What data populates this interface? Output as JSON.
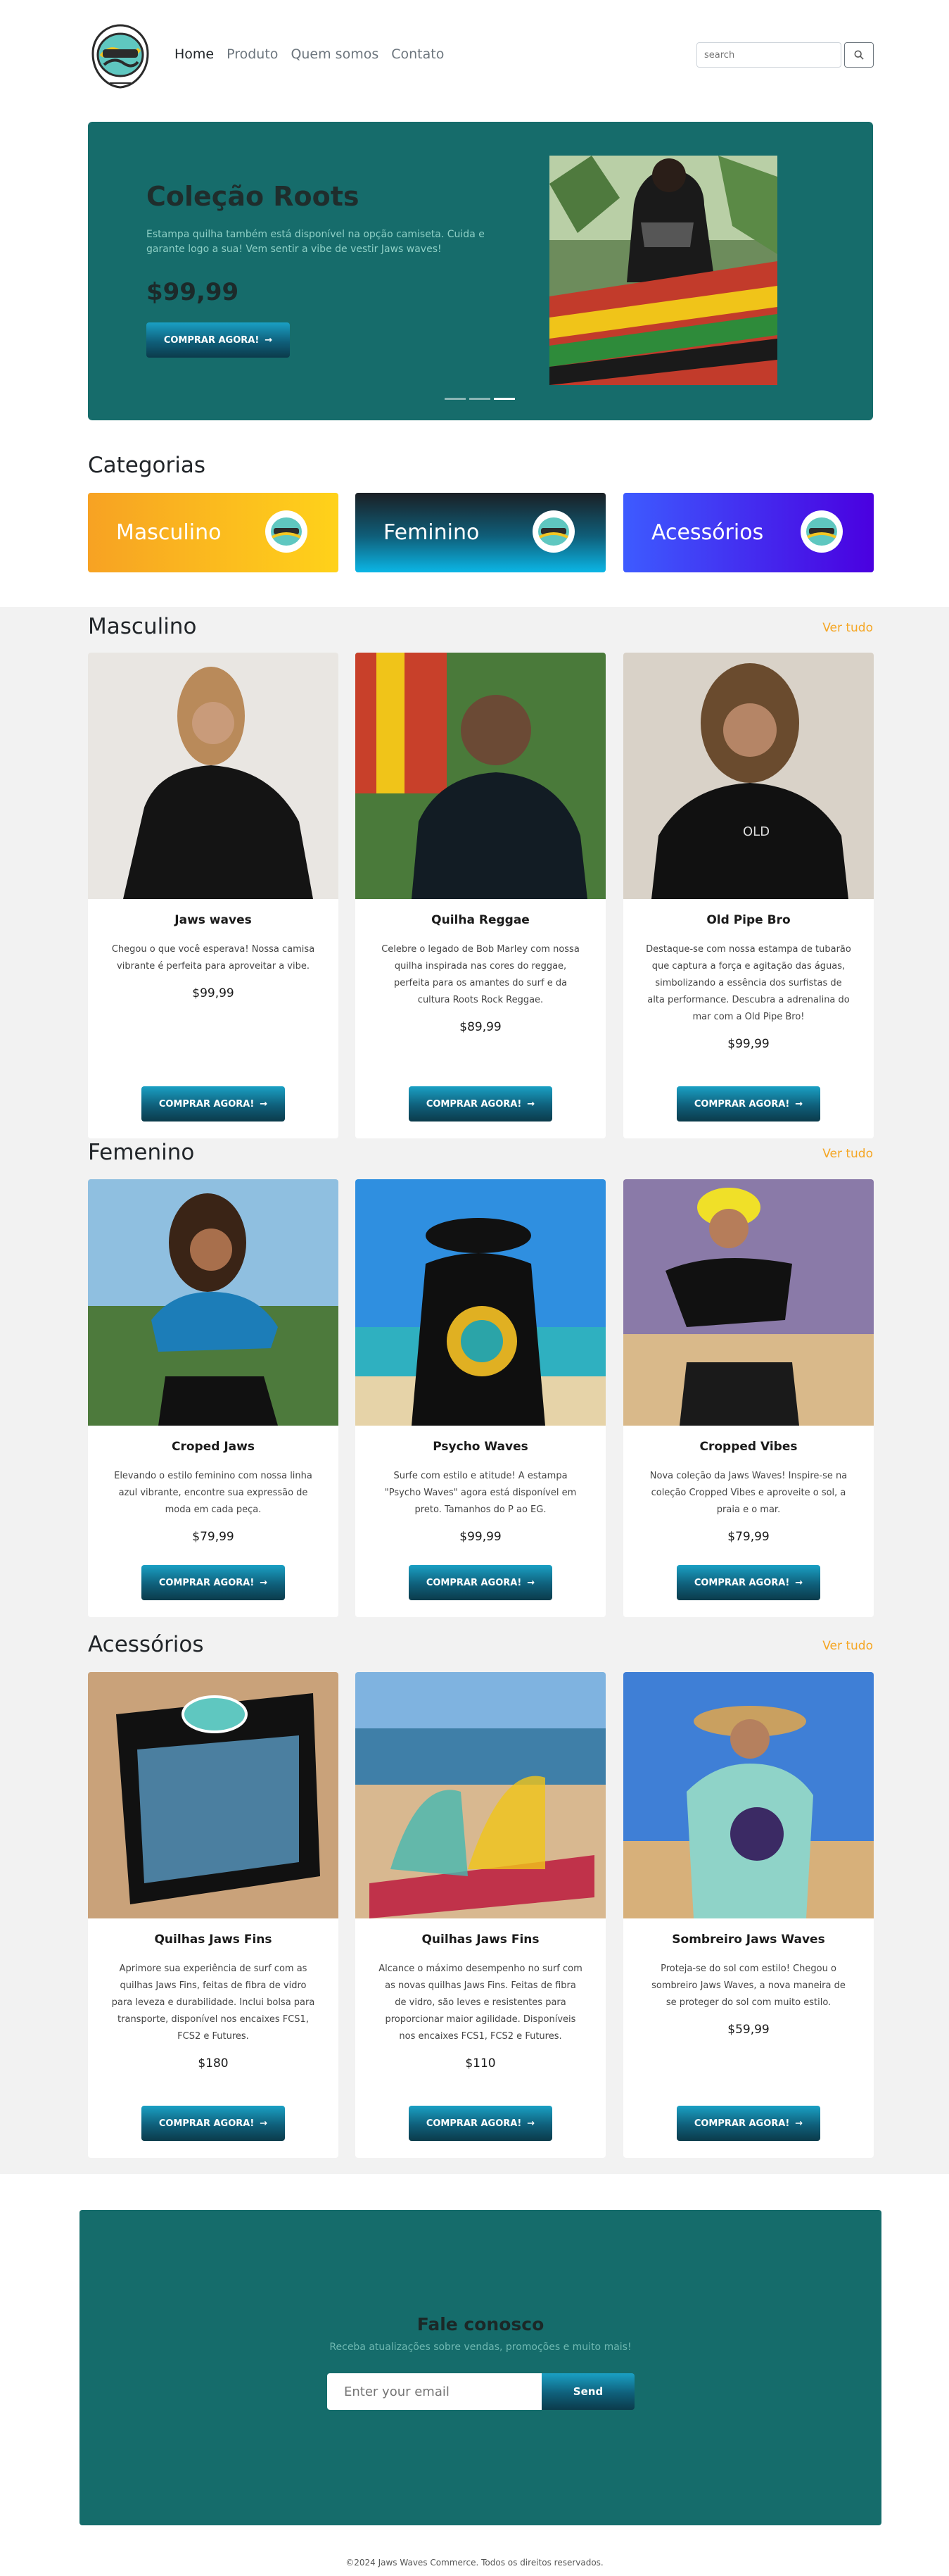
{
  "nav": {
    "links": [
      "Home",
      "Produto",
      "Quem somos",
      "Contato"
    ],
    "search_placeholder": "search"
  },
  "hero": {
    "title": "Coleção Roots",
    "description": "Estampa quilha também está disponível na opção camiseta. Cuida e garante logo a sua! Vem sentir a vibe de vestir Jaws waves!",
    "price": "$99,99",
    "button": "COMPRAR AGORA!",
    "slides": 3,
    "active_slide": 3
  },
  "categories": {
    "title": "Categorias",
    "items": [
      {
        "label": "Masculino",
        "color_from": "#f7a223",
        "color_to": "#ffd21a"
      },
      {
        "label": "Feminino",
        "color_from": "#1a1f24",
        "color_to": "#0bb6e6"
      },
      {
        "label": "Acessórios",
        "color_from": "#3d5bff",
        "color_to": "#4a00e0"
      }
    ]
  },
  "sections": [
    {
      "title": "Masculino",
      "link": "Ver tudo",
      "products": [
        {
          "name": "Jaws waves",
          "description": "Chegou o que você esperava! Nossa camisa vibrante é perfeita para aproveitar a vibe.",
          "price": "$99,99",
          "button": "COMPRAR AGORA!"
        },
        {
          "name": "Quilha Reggae",
          "description": "Celebre o legado de Bob Marley com nossa quilha inspirada nas cores do reggae, perfeita para os amantes do surf e da cultura Roots Rock Reggae.",
          "price": "$89,99",
          "button": "COMPRAR AGORA!"
        },
        {
          "name": "Old Pipe Bro",
          "description": "Destaque-se com nossa estampa de tubarão que captura a força e agitação das águas, simbolizando a essência dos surfistas de alta performance. Descubra a adrenalina do mar com a Old Pipe Bro!",
          "price": "$99,99",
          "button": "COMPRAR AGORA!"
        }
      ]
    },
    {
      "title": "Femenino",
      "link": "Ver tudo",
      "products": [
        {
          "name": "Croped Jaws",
          "description": "Elevando o estilo feminino com nossa linha azul vibrante, encontre sua expressão de moda em cada peça.",
          "price": "$79,99",
          "button": "COMPRAR AGORA!"
        },
        {
          "name": "Psycho Waves",
          "description": "Surfe com estilo e atitude! A estampa \"Psycho Waves\" agora está disponível em preto. Tamanhos do P ao EG.",
          "price": "$99,99",
          "button": "COMPRAR AGORA!"
        },
        {
          "name": "Cropped Vibes",
          "description": "Nova coleção da Jaws Waves! Inspire-se na coleção Cropped Vibes e aproveite o sol, a praia e o mar.",
          "price": "$79,99",
          "button": "COMPRAR AGORA!"
        }
      ]
    },
    {
      "title": "Acessórios",
      "link": "Ver tudo",
      "products": [
        {
          "name": "Quilhas Jaws Fins",
          "description": "Aprimore sua experiência de surf com as quilhas Jaws Fins, feitas de fibra de vidro para leveza e durabilidade. Inclui bolsa para transporte, disponível nos encaixes FCS1, FCS2 e Futures.",
          "price": "$180",
          "button": "COMPRAR AGORA!"
        },
        {
          "name": "Quilhas Jaws Fins",
          "description": "Alcance o máximo desempenho no surf com as novas quilhas Jaws Fins. Feitas de fibra de vidro, são leves e resistentes para proporcionar maior agilidade. Disponíveis nos encaixes FCS1, FCS2 e Futures.",
          "price": "$110",
          "button": "COMPRAR AGORA!"
        },
        {
          "name": "Sombreiro Jaws Waves",
          "description": "Proteja-se do sol com estilo! Chegou o sombreiro Jaws Waves, a nova maneira de se proteger do sol com muito estilo.",
          "price": "$59,99",
          "button": "COMPRAR AGORA!"
        }
      ]
    }
  ],
  "newsletter": {
    "title": "Fale conosco",
    "subtitle": "Receba atualizações sobre vendas, promoções e muito mais!",
    "placeholder": "Enter your email",
    "button": "Send"
  },
  "footer": "©2024 Jaws Waves Commerce. Todos os direitos reservados."
}
